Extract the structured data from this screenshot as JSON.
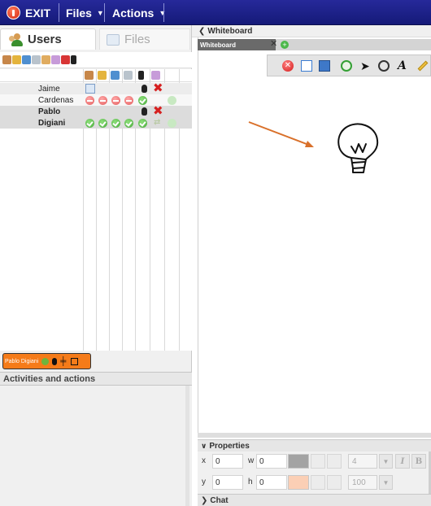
{
  "topbar": {
    "exit_label": "EXIT",
    "files_label": "Files",
    "actions_label": "Actions",
    "caret": "⌄"
  },
  "tabs": {
    "users_label": "Users",
    "files_label": "Files"
  },
  "users": [
    {
      "name_line1": "Jaime",
      "name_line2": "Cardenas"
    },
    {
      "name_line1": "Pablo",
      "name_line2": "Digiani"
    }
  ],
  "selected_user": {
    "name": "Pablo Digiani"
  },
  "activities": {
    "title": "Activities and actions"
  },
  "whiteboard": {
    "panel_title": "Whiteboard",
    "tab_label": "Whiteboard",
    "tab_close": "✕",
    "tab_add": "+"
  },
  "properties": {
    "title": "Properties",
    "x_label": "x",
    "x_value": "0",
    "y_label": "y",
    "y_value": "0",
    "w_label": "w",
    "w_value": "0",
    "h_label": "h",
    "h_value": "0",
    "line_width": "4",
    "opacity": "100",
    "italic_label": "I",
    "bold_label": "B"
  },
  "chat": {
    "title": "Chat"
  },
  "colors": {
    "topbar": "#1c208a",
    "selected_user": "#f57b19",
    "arrow": "#d9702a"
  }
}
